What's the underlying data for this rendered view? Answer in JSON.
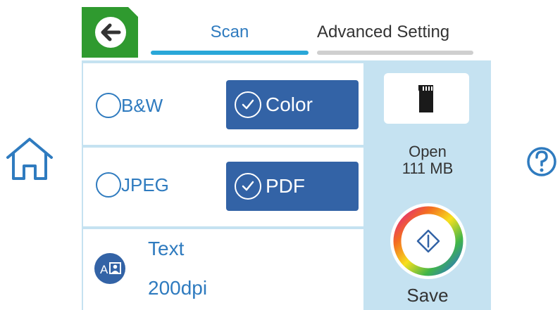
{
  "tabs": [
    {
      "label": "Scan"
    },
    {
      "label": "Advanced Setting"
    }
  ],
  "color_mode": {
    "bw_label": "B&W",
    "color_label": "Color"
  },
  "format": {
    "jpeg_label": "JPEG",
    "pdf_label": "PDF"
  },
  "resolution": {
    "type_label": "Text",
    "dpi_label": "200dpi"
  },
  "destination": {
    "status": "Open",
    "free_space": "111 MB"
  },
  "start_label": "Save",
  "icons": [
    "back-icon",
    "home-icon",
    "help-icon",
    "sd-card-icon",
    "start-icon",
    "text-mode-icon"
  ]
}
